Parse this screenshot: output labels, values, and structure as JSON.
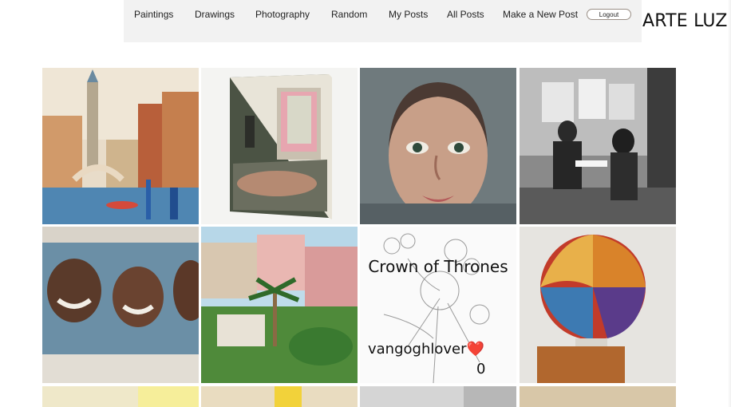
{
  "nav": {
    "items": [
      {
        "label": "Paintings"
      },
      {
        "label": "Drawings"
      },
      {
        "label": "Photography"
      },
      {
        "label": "Random"
      },
      {
        "label": "My Posts"
      },
      {
        "label": "All Posts"
      },
      {
        "label": "Make a New Post"
      }
    ],
    "logout_label": "Logout"
  },
  "brand": "ARTE LUZ",
  "gallery": {
    "tiles": [
      {
        "image": "venice-canal-watercolor"
      },
      {
        "image": "bedroom-interior-painting"
      },
      {
        "image": "woman-portrait-mosaic"
      },
      {
        "image": "subway-artist-sketching-photo"
      },
      {
        "image": "three-men-smiling-painting"
      },
      {
        "image": "pink-city-palms-painting"
      },
      {
        "image": "flower-line-drawing",
        "hover": {
          "title": "Crown of Thrones",
          "user": "vangoghlover",
          "heart": "❤️",
          "likes": "0"
        }
      },
      {
        "image": "painted-sphere-sculpture"
      }
    ]
  }
}
